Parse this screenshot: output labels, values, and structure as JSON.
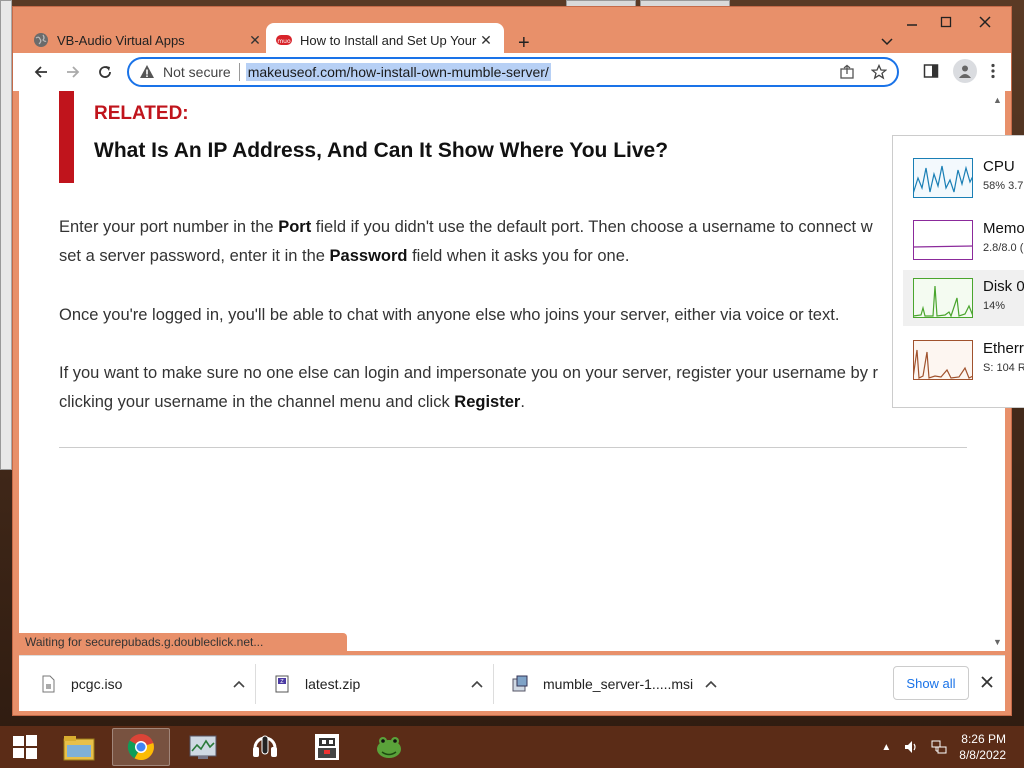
{
  "browser": {
    "tabs": [
      {
        "title": "VB-Audio Virtual Apps",
        "active": false
      },
      {
        "title": "How to Install and Set Up Your O",
        "active": true
      }
    ],
    "omnibox": {
      "security": "Not secure",
      "url": "makeuseof.com/how-install-own-mumble-server/"
    },
    "status": "Waiting for securepubads.g.doubleclick.net..."
  },
  "article": {
    "related_label": "RELATED:",
    "related_headline": "What Is An IP Address, And Can It Show Where You Live?",
    "p1_a": "Enter your port number in the ",
    "p1_b": "Port",
    "p1_c": " field if you didn't use the default port. Then choose a username to connect w",
    "p1_d": "set a server password, enter it in the ",
    "p1_e": "Password",
    "p1_f": " field when it asks you for one.",
    "p2": "Once you're logged in, you'll be able to chat with anyone else who joins your server, either via voice or text.",
    "p3_a": "If you want to make sure no one else can login and impersonate you on your server, register your username by r",
    "p3_b": "clicking your username in the channel menu and click ",
    "p3_c": "Register",
    "p3_d": "."
  },
  "downloads": {
    "items": [
      {
        "name": "pcgc.iso"
      },
      {
        "name": "latest.zip"
      },
      {
        "name": "mumble_server-1.....msi"
      }
    ],
    "show_all": "Show all"
  },
  "perf": {
    "items": [
      {
        "name": "CPU",
        "value": "58%  3.7",
        "color": "#1a7fb5"
      },
      {
        "name": "Memo",
        "value": "2.8/8.0 (",
        "color": "#8b2a9b"
      },
      {
        "name": "Disk 0",
        "value": "14%",
        "color": "#4aa52e"
      },
      {
        "name": "Etherr",
        "value": "S: 104 R",
        "color": "#a0522d"
      }
    ]
  },
  "taskbar": {
    "time": "8:26 PM",
    "date": "8/8/2022"
  },
  "colors": {
    "accent": "#1a73e8",
    "related_red": "#c0141c",
    "chrome_frame": "#e8906a",
    "taskbar": "#5b2c17"
  }
}
